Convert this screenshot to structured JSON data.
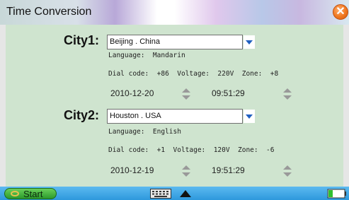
{
  "window": {
    "title": "Time Conversion"
  },
  "cities": [
    {
      "label": "City1:",
      "selected": "Beijing . China",
      "language": "Language:  Mandarin",
      "info": "Dial code:  +86  Voltage:  220V  Zone:  +8",
      "date": "2010-12-20",
      "time": "09:51:29"
    },
    {
      "label": "City2:",
      "selected": "Houston . USA",
      "language": "Language:  English",
      "info": "Dial code:  +1  Voltage:  120V  Zone:  -6",
      "date": "2010-12-19",
      "time": "19:51:29"
    }
  ],
  "taskbar": {
    "start_label": "Start"
  },
  "colors": {
    "content_bg": "#cfe4cf",
    "taskbar": "#3aa6e6",
    "close": "#f07820",
    "start": "#44b344",
    "dropdown_arrow": "#2060c0"
  },
  "icons": {
    "close": "close-x-icon",
    "dropdown": "chevron-down-icon",
    "spinner": "up-down-spinner-icon",
    "keyboard": "keyboard-icon",
    "up": "triangle-up-icon",
    "battery": "battery-icon"
  }
}
